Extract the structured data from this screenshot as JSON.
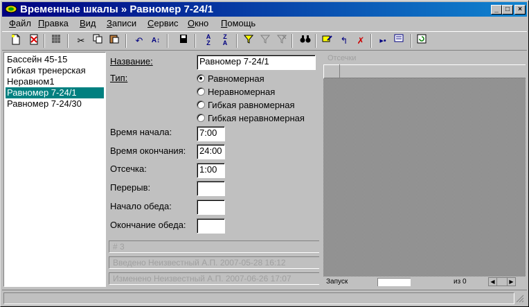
{
  "window": {
    "title": "Временные шкалы » Равномер 7-24/1",
    "title_icon": "app-icon",
    "controls": [
      "_",
      "□",
      "×"
    ]
  },
  "menu": [
    {
      "label": "Файл",
      "accel": "Ф",
      "rest": "айл"
    },
    {
      "label": "Правка",
      "accel": "П",
      "rest": "равка"
    },
    {
      "label": "Вид",
      "accel": "В",
      "rest": "ид"
    },
    {
      "label": "Записи",
      "accel": "З",
      "rest": "аписи"
    },
    {
      "label": "Сервис",
      "accel": "С",
      "rest": "ервис"
    },
    {
      "label": "Окно",
      "accel": "О",
      "rest": "кно"
    },
    {
      "label": "Помощь",
      "accel": "П",
      "rest": "омощь"
    }
  ],
  "toolbar_icons": [
    "new-icon",
    "delete-icon",
    "grid-icon",
    "cut-icon",
    "copy-icon",
    "paste-icon",
    "undo-icon",
    "sort-icon",
    "save-icon",
    "sort-asc-icon",
    "sort-desc-icon",
    "filter-icon",
    "filter-off-icon",
    "filter-clear-icon",
    "find-icon",
    "edit-record-icon",
    "refresh-record-icon",
    "cancel-record-icon",
    "run-icon",
    "print-preview-icon",
    "refresh-icon"
  ],
  "list": {
    "items": [
      "Бассейн 45-15",
      "Гибкая тренерская",
      "Неравном1",
      "Равномер 7-24/1",
      "Равномер 7-24/30"
    ],
    "selected_index": 3
  },
  "form": {
    "name_label": "Название:",
    "name_value": "Равномер 7-24/1",
    "type_label": "Тип:",
    "type_options": [
      "Равномерная",
      "Неравномерная",
      "Гибкая равномерная",
      "Гибкая неравномерная"
    ],
    "type_selected": 0,
    "start_label": "Время начала:",
    "start_value": "7:00",
    "end_label": "Время окончания:",
    "end_value": "24:00",
    "cutoff_label": "Отсечка:",
    "cutoff_value": "1:00",
    "break_label": "Перерыв:",
    "break_value": "",
    "lunch_start_label": "Начало обеда:",
    "lunch_start_value": "",
    "lunch_end_label": "Окончание обеда:",
    "lunch_end_value": ""
  },
  "record_info": {
    "number": "# 3",
    "entered": "Введено    Неизвестный А.П. 2007-05-28 16:12",
    "changed": "Изменено  Неизвестный А.П. 2007-06-26 17:07"
  },
  "cutoffs": {
    "title": "Отсечки",
    "launch_label": "Запуск",
    "of_label": "из 0"
  },
  "colors": {
    "title_start": "#000080",
    "title_end": "#1084d0",
    "selection": "#008080",
    "face": "#c0c0c0"
  }
}
